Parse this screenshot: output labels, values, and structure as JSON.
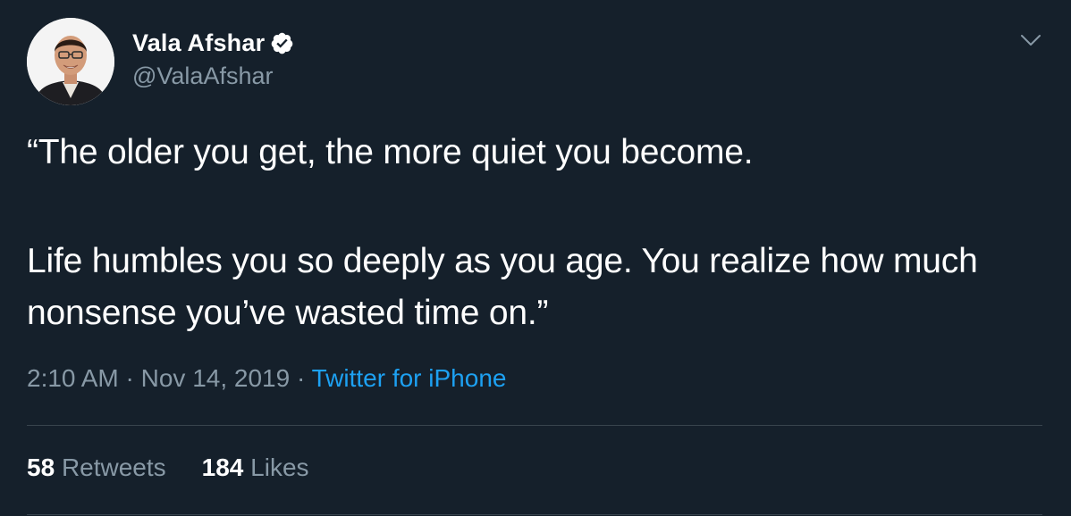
{
  "author": {
    "display_name": "Vala Afshar",
    "handle": "@ValaAfshar",
    "verified": true,
    "avatar_icon": "profile-photo"
  },
  "tweet": {
    "paragraphs": [
      "“The older you get, the more quiet you become.",
      "Life humbles you so deeply as you age. You realize how much nonsense you’ve wasted time on.”"
    ],
    "time": "2:10 AM",
    "separator": "·",
    "date": "Nov 14, 2019",
    "source": "Twitter for iPhone"
  },
  "stats": {
    "retweets_count": "58",
    "retweets_label": "Retweets",
    "likes_count": "184",
    "likes_label": "Likes"
  },
  "icons": {
    "verified": "verified-badge-icon",
    "menu": "chevron-down-icon"
  },
  "colors": {
    "background": "#15202b",
    "text_primary": "#ffffff",
    "text_secondary": "#8899a6",
    "link": "#1da1f2",
    "divider": "#38444d"
  }
}
